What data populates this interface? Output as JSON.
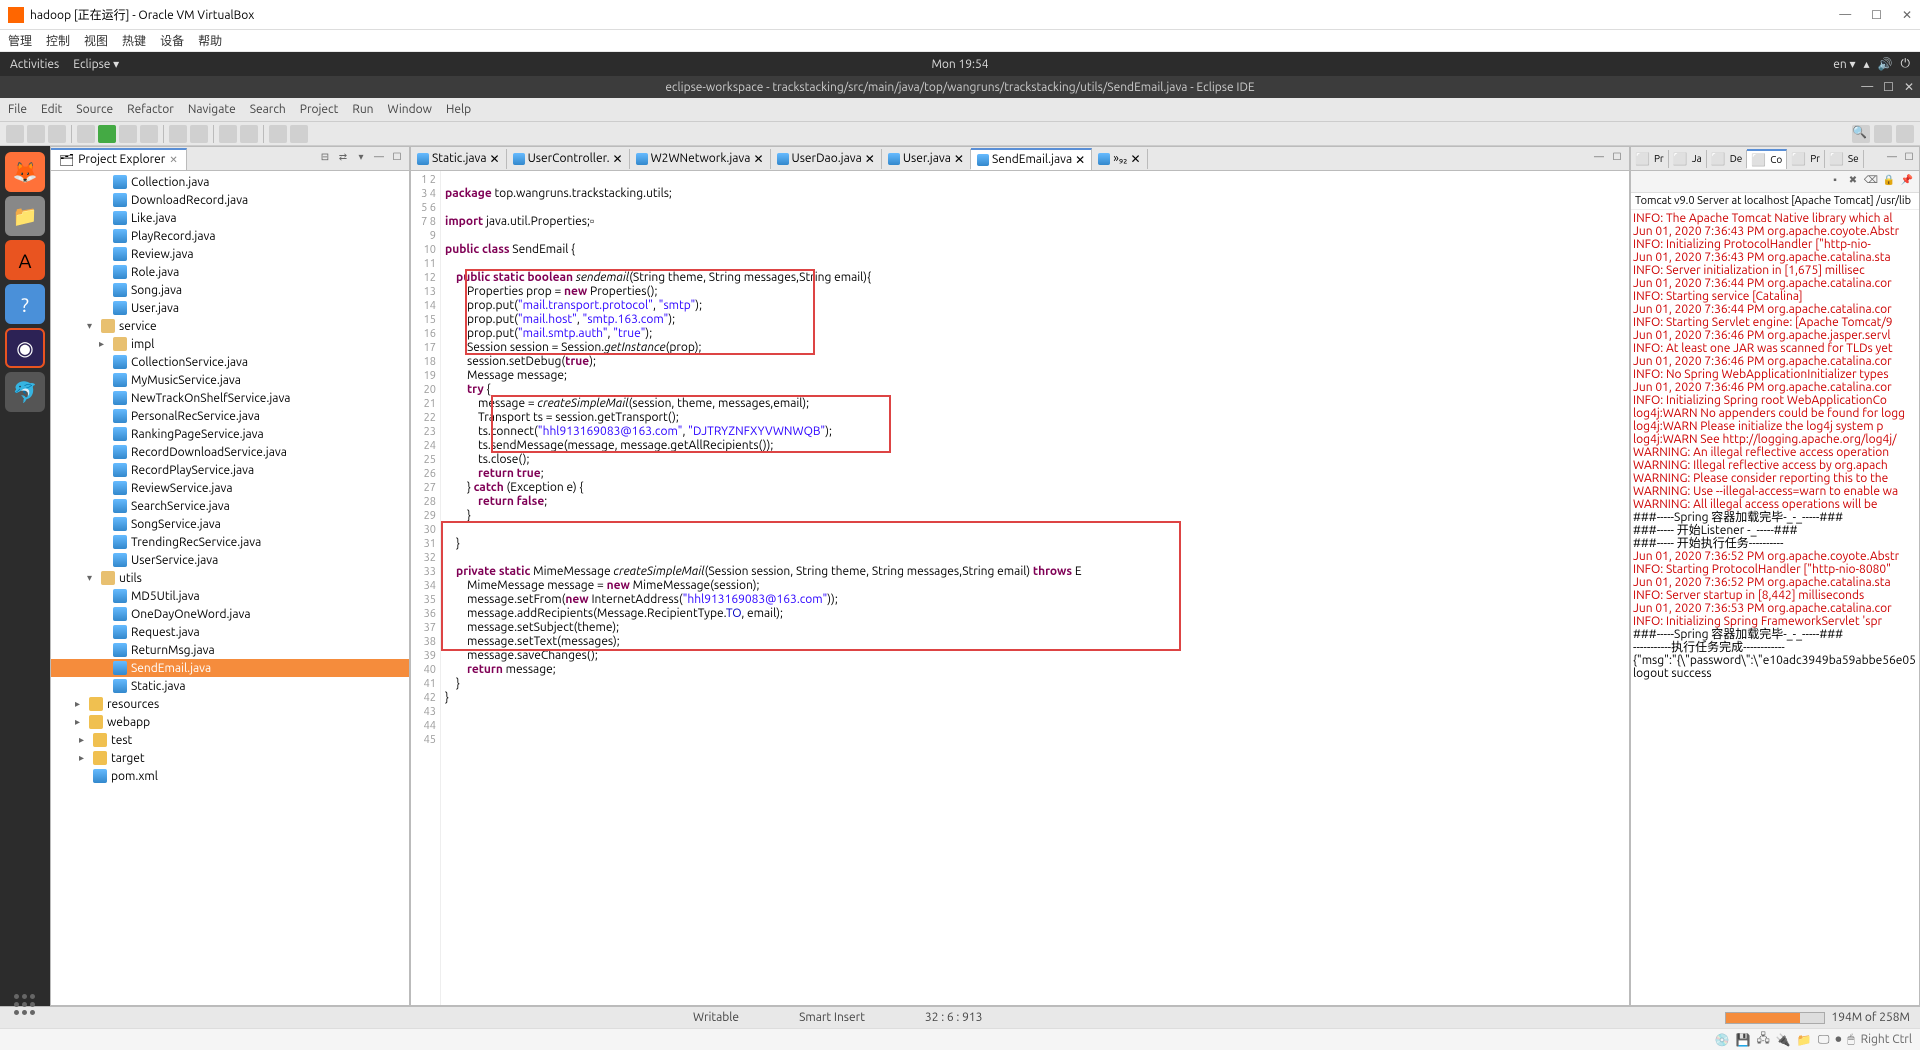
{
  "vbox": {
    "title": "hadoop [正在运行] - Oracle VM VirtualBox",
    "menu": [
      "管理",
      "控制",
      "视图",
      "热键",
      "设备",
      "帮助"
    ]
  },
  "ubuntu": {
    "activities": "Activities",
    "app": "Eclipse ▾",
    "clock": "Mon 19:54",
    "lang": "en ▾"
  },
  "eclipse": {
    "title": "eclipse-workspace - trackstacking/src/main/java/top/wangruns/trackstacking/utils/SendEmail.java - Eclipse IDE",
    "menu": [
      "File",
      "Edit",
      "Source",
      "Refactor",
      "Navigate",
      "Search",
      "Project",
      "Run",
      "Window",
      "Help"
    ]
  },
  "explorer": {
    "title": "Project Explorer",
    "items": [
      {
        "n": "Collection.java",
        "t": "java",
        "l": 4
      },
      {
        "n": "DownloadRecord.java",
        "t": "java",
        "l": 4
      },
      {
        "n": "Like.java",
        "t": "java",
        "l": 4
      },
      {
        "n": "PlayRecord.java",
        "t": "java",
        "l": 4
      },
      {
        "n": "Review.java",
        "t": "java",
        "l": 4
      },
      {
        "n": "Role.java",
        "t": "java",
        "l": 4
      },
      {
        "n": "Song.java",
        "t": "java",
        "l": 4
      },
      {
        "n": "User.java",
        "t": "java",
        "l": 4
      },
      {
        "n": "service",
        "t": "pkg",
        "l": 3,
        "arrow": "▾"
      },
      {
        "n": "impl",
        "t": "pkg",
        "l": 4,
        "arrow": "▸"
      },
      {
        "n": "CollectionService.java",
        "t": "java",
        "l": 4
      },
      {
        "n": "MyMusicService.java",
        "t": "java",
        "l": 4
      },
      {
        "n": "NewTrackOnShelfService.java",
        "t": "java",
        "l": 4
      },
      {
        "n": "PersonalRecService.java",
        "t": "java",
        "l": 4
      },
      {
        "n": "RankingPageService.java",
        "t": "java",
        "l": 4
      },
      {
        "n": "RecordDownloadService.java",
        "t": "java",
        "l": 4
      },
      {
        "n": "RecordPlayService.java",
        "t": "java",
        "l": 4
      },
      {
        "n": "ReviewService.java",
        "t": "java",
        "l": 4
      },
      {
        "n": "SearchService.java",
        "t": "java",
        "l": 4
      },
      {
        "n": "SongService.java",
        "t": "java",
        "l": 4
      },
      {
        "n": "TrendingRecService.java",
        "t": "java",
        "l": 4
      },
      {
        "n": "UserService.java",
        "t": "java",
        "l": 4
      },
      {
        "n": "utils",
        "t": "pkg",
        "l": 3,
        "arrow": "▾"
      },
      {
        "n": "MD5Util.java",
        "t": "java",
        "l": 4
      },
      {
        "n": "OneDayOneWord.java",
        "t": "java",
        "l": 4
      },
      {
        "n": "Request.java",
        "t": "java",
        "l": 4
      },
      {
        "n": "ReturnMsg.java",
        "t": "java",
        "l": 4
      },
      {
        "n": "SendEmail.java",
        "t": "java",
        "l": 4,
        "sel": true
      },
      {
        "n": "Static.java",
        "t": "java",
        "l": 4
      },
      {
        "n": "resources",
        "t": "fold",
        "l": 2,
        "arrow": "▸"
      },
      {
        "n": "webapp",
        "t": "fold",
        "l": 2,
        "arrow": "▸"
      },
      {
        "n": "test",
        "t": "fold",
        "l": 1,
        "arrow": "▸"
      },
      {
        "n": "target",
        "t": "fold",
        "l": 1,
        "arrow": "▸"
      },
      {
        "n": "pom.xml",
        "t": "java",
        "l": 1
      }
    ]
  },
  "tabs": [
    {
      "n": "Static.java"
    },
    {
      "n": "UserController."
    },
    {
      "n": "W2WNetwork.java"
    },
    {
      "n": "UserDao.java"
    },
    {
      "n": "User.java"
    },
    {
      "n": "SendEmail.java",
      "active": true
    },
    {
      "n": "»₉₂"
    }
  ],
  "statusbar": {
    "writable": "Writable",
    "insert": "Smart Insert",
    "pos": "32 : 6 : 913",
    "mem": "194M of 258M"
  },
  "console": {
    "header": "Tomcat v9.0 Server at localhost [Apache Tomcat] /usr/lib",
    "tabs": [
      "Pr",
      "Ja",
      "De",
      "Co",
      "Pr",
      "Se"
    ],
    "lines": [
      "INFO: The Apache Tomcat Native library which al",
      "Jun 01, 2020 7:36:43 PM org.apache.coyote.Abstr",
      "INFO: Initializing ProtocolHandler [\"http-nio-",
      "Jun 01, 2020 7:36:43 PM org.apache.catalina.sta",
      "INFO: Server initialization in [1,675] millisec",
      "Jun 01, 2020 7:36:44 PM org.apache.catalina.cor",
      "INFO: Starting service [Catalina]",
      "Jun 01, 2020 7:36:44 PM org.apache.catalina.cor",
      "INFO: Starting Servlet engine: [Apache Tomcat/9",
      "Jun 01, 2020 7:36:46 PM org.apache.jasper.servl",
      "INFO: At least one JAR was scanned for TLDs yet",
      "Jun 01, 2020 7:36:46 PM org.apache.catalina.cor",
      "INFO: No Spring WebApplicationInitializer types",
      "Jun 01, 2020 7:36:46 PM org.apache.catalina.cor",
      "INFO: Initializing Spring root WebApplicationCo",
      "log4j:WARN No appenders could be found for logg",
      "log4j:WARN Please initialize the log4j system p",
      "log4j:WARN See http://logging.apache.org/log4j/",
      "WARNING: An illegal reflective access operation",
      "WARNING: Illegal reflective access by org.apach",
      "WARNING: Please consider reporting this to the ",
      "WARNING: Use --illegal-access=warn to enable wa",
      "WARNING: All illegal access operations will be ",
      "###-----Spring 容器加载完毕-_-_-----###",
      "###----- 开始Listener -_-----###",
      "###----- 开始执行任务----------",
      "Jun 01, 2020 7:36:52 PM org.apache.coyote.Abstr",
      "INFO: Starting ProtocolHandler [\"http-nio-8080\"",
      "Jun 01, 2020 7:36:52 PM org.apache.catalina.sta",
      "INFO: Server startup in [8,442] milliseconds",
      "Jun 01, 2020 7:36:53 PM org.apache.catalina.cor",
      "INFO: Initializing Spring FrameworkServlet 'spr",
      "###-----Spring 容器加载完毕-_-_-----###",
      "-----------执行任务完成------------",
      "{\"msg\":\"{\\\"password\\\":\\\"e10adc3949ba59abbe56e05",
      "logout success"
    ]
  },
  "vbox_status": {
    "right": "Right Ctrl"
  }
}
